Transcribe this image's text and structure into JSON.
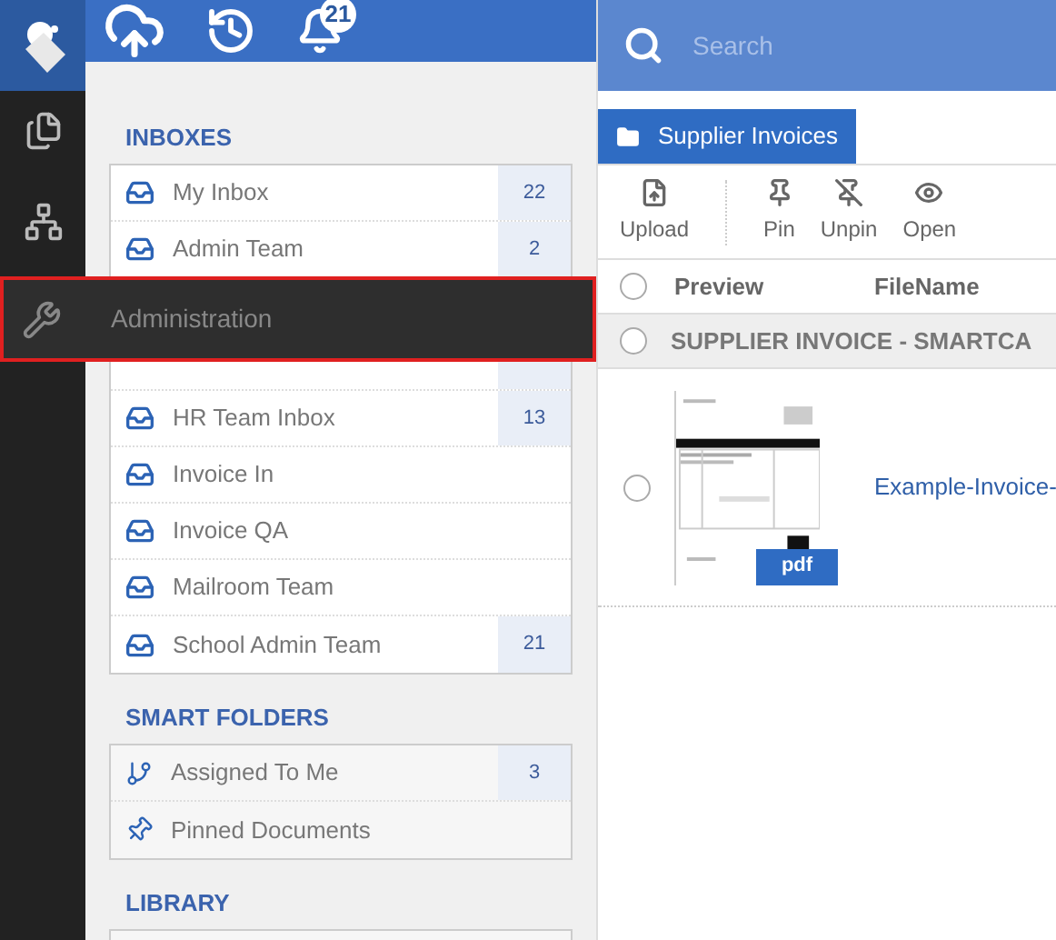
{
  "top_bar": {
    "notification_count": "21",
    "search": {
      "placeholder": "Search"
    }
  },
  "rail": {
    "items": [
      {
        "kind": "document"
      },
      {
        "kind": "hierarchy"
      }
    ]
  },
  "flyout": {
    "label": "Administration",
    "highlighted": true
  },
  "sidebar": {
    "sections": [
      {
        "title": "INBOXES",
        "kind": "inbox",
        "items": [
          {
            "label": "My Inbox",
            "count": "22"
          },
          {
            "label": "Admin Team",
            "count": "2"
          },
          {
            "label": "HR Team Inbox",
            "count": "13"
          },
          {
            "label": "Invoice In"
          },
          {
            "label": "Invoice QA"
          },
          {
            "label": "Mailroom Team"
          },
          {
            "label": "School Admin Team",
            "count": "21"
          }
        ]
      },
      {
        "title": "SMART FOLDERS",
        "kind": "smart",
        "items": [
          {
            "label": "Assigned To Me",
            "count": "3",
            "kind": "assigned"
          },
          {
            "label": "Pinned Documents",
            "kind": "pinned"
          }
        ]
      },
      {
        "title": "LIBRARY",
        "kind": "library"
      }
    ]
  },
  "main": {
    "tab": {
      "label": "Supplier Invoices",
      "selected": true
    },
    "toolbar": [
      {
        "label": "Upload"
      },
      {
        "label": "Pin"
      },
      {
        "label": "Unpin"
      },
      {
        "label": "Open"
      }
    ],
    "columns": [
      "Preview",
      "FileName"
    ],
    "header_checked": false,
    "group": {
      "label": "SUPPLIER INVOICE - SMARTCA",
      "checked": false
    },
    "rows": [
      {
        "file_type": "pdf",
        "filename": "Example-Invoice-",
        "checked": false
      }
    ]
  }
}
